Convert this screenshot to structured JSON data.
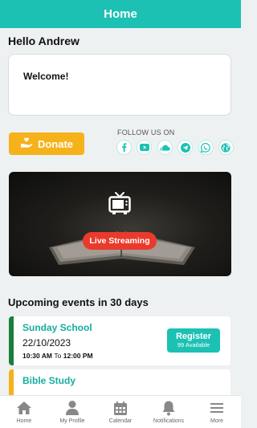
{
  "header": {
    "title": "Home"
  },
  "greeting": "Hello Andrew",
  "welcome": {
    "text": "Welcome!"
  },
  "donate": {
    "label": "Donate",
    "color": "#f6b21a"
  },
  "follow": {
    "label": "FOLLOW US ON",
    "icons": [
      "facebook-icon",
      "youtube-icon",
      "soundcloud-icon",
      "telegram-icon",
      "whatsapp-icon",
      "globe-icon"
    ]
  },
  "live": {
    "label": "Live Streaming",
    "color": "#ea3a2c"
  },
  "events": {
    "title": "Upcoming events in 30 days",
    "items": [
      {
        "name": "Sunday School",
        "date": "22/10/2023",
        "start": "10:30 AM",
        "to": "To",
        "end": "12:00 PM",
        "register_label": "Register",
        "availability": "99 Available",
        "accent": "#1a7f3c"
      },
      {
        "name": "Bible Study",
        "accent": "#f6b21a"
      }
    ]
  },
  "tabs": [
    {
      "label": "Home",
      "icon": "home-icon"
    },
    {
      "label": "My Profile",
      "icon": "profile-icon"
    },
    {
      "label": "Calendar",
      "icon": "calendar-icon"
    },
    {
      "label": "Notifications",
      "icon": "bell-icon"
    },
    {
      "label": "More",
      "icon": "menu-icon"
    }
  ],
  "colors": {
    "accent": "#1cc1b4",
    "background": "#eef1f2"
  }
}
